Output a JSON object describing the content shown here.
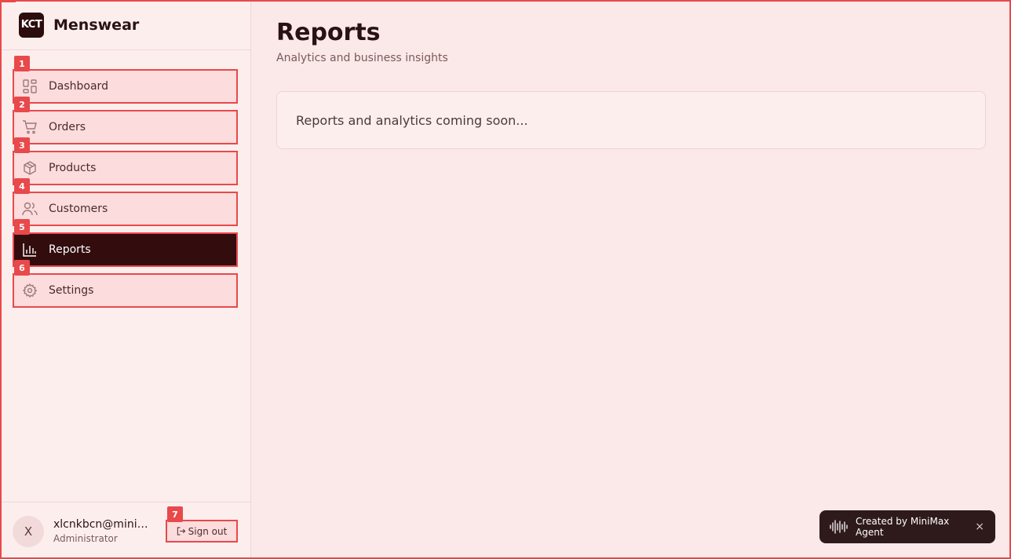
{
  "brand": {
    "logo_text": "KCT",
    "name": "Menswear"
  },
  "nav": {
    "items": [
      {
        "badge": "1",
        "label": "Dashboard",
        "icon": "dashboard-icon",
        "active": false
      },
      {
        "badge": "2",
        "label": "Orders",
        "icon": "cart-icon",
        "active": false
      },
      {
        "badge": "3",
        "label": "Products",
        "icon": "package-icon",
        "active": false
      },
      {
        "badge": "4",
        "label": "Customers",
        "icon": "users-icon",
        "active": false
      },
      {
        "badge": "5",
        "label": "Reports",
        "icon": "bar-chart-icon",
        "active": true
      },
      {
        "badge": "6",
        "label": "Settings",
        "icon": "gear-icon",
        "active": false
      }
    ]
  },
  "user": {
    "avatar_initial": "X",
    "email": "xlcnkbcn@minimax.com",
    "role": "Administrator",
    "signout_badge": "7",
    "signout_label": "Sign out"
  },
  "page": {
    "title": "Reports",
    "subtitle": "Analytics and business insights",
    "card_text": "Reports and analytics coming soon..."
  },
  "toast": {
    "text": "Created by MiniMax Agent",
    "close_glyph": "×"
  },
  "colors": {
    "accent": "#e8494b",
    "active_bg": "#330c0e",
    "page_bg": "#fbe8e8",
    "sidebar_bg": "#fdeeee"
  }
}
